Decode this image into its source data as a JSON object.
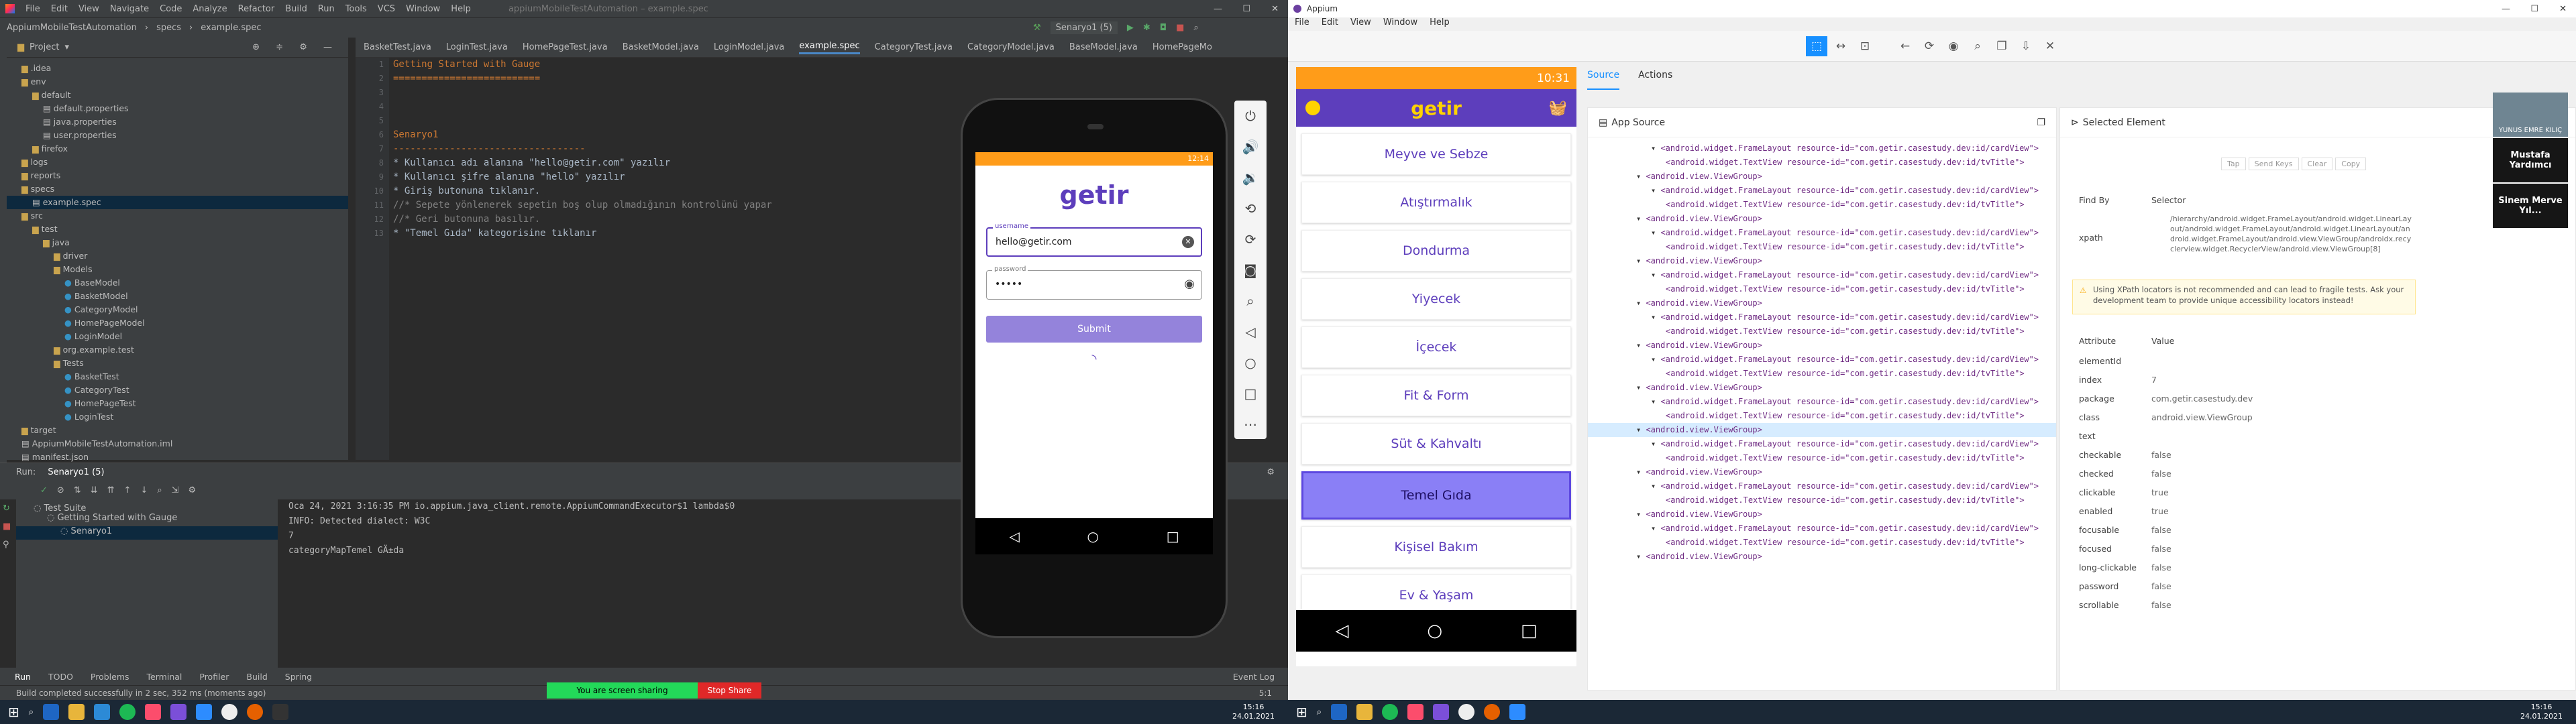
{
  "ide": {
    "menu": [
      "File",
      "Edit",
      "View",
      "Navigate",
      "Code",
      "Analyze",
      "Refactor",
      "Build",
      "Run",
      "Tools",
      "VCS",
      "Window",
      "Help"
    ],
    "window_title": "appiumMobileTestAutomation – example.spec",
    "breadcrumb": [
      "AppiumMobileTestAutomation",
      "specs",
      "example.spec"
    ],
    "run_config": "Senaryo1 (5)",
    "tabs": [
      "BasketTest.java",
      "LoginTest.java",
      "HomePageTest.java",
      "BasketModel.java",
      "LoginModel.java",
      "example.spec",
      "CategoryTest.java",
      "CategoryModel.java",
      "BaseModel.java",
      "HomePageMo"
    ],
    "active_tab": "example.spec",
    "project_label": "Project",
    "tree": [
      {
        "label": ".idea",
        "indent": 2,
        "type": "folder"
      },
      {
        "label": "env",
        "indent": 2,
        "type": "folder"
      },
      {
        "label": "default",
        "indent": 3,
        "type": "folder"
      },
      {
        "label": "default.properties",
        "indent": 4,
        "type": "file"
      },
      {
        "label": "java.properties",
        "indent": 4,
        "type": "file"
      },
      {
        "label": "user.properties",
        "indent": 4,
        "type": "file"
      },
      {
        "label": "firefox",
        "indent": 3,
        "type": "folder"
      },
      {
        "label": "logs",
        "indent": 2,
        "type": "folder"
      },
      {
        "label": "reports",
        "indent": 2,
        "type": "folder"
      },
      {
        "label": "specs",
        "indent": 2,
        "type": "folder"
      },
      {
        "label": "example.spec",
        "indent": 3,
        "type": "file",
        "selected": true
      },
      {
        "label": "src",
        "indent": 2,
        "type": "folder"
      },
      {
        "label": "test",
        "indent": 3,
        "type": "folder"
      },
      {
        "label": "java",
        "indent": 4,
        "type": "folder"
      },
      {
        "label": "driver",
        "indent": 5,
        "type": "folder"
      },
      {
        "label": "Models",
        "indent": 5,
        "type": "folder"
      },
      {
        "label": "BaseModel",
        "indent": 6,
        "type": "class"
      },
      {
        "label": "BasketModel",
        "indent": 6,
        "type": "class"
      },
      {
        "label": "CategoryModel",
        "indent": 6,
        "type": "class"
      },
      {
        "label": "HomePageModel",
        "indent": 6,
        "type": "class"
      },
      {
        "label": "LoginModel",
        "indent": 6,
        "type": "class"
      },
      {
        "label": "org.example.test",
        "indent": 5,
        "type": "folder"
      },
      {
        "label": "Tests",
        "indent": 5,
        "type": "folder"
      },
      {
        "label": "BasketTest",
        "indent": 6,
        "type": "class"
      },
      {
        "label": "CategoryTest",
        "indent": 6,
        "type": "class"
      },
      {
        "label": "HomePageTest",
        "indent": 6,
        "type": "class"
      },
      {
        "label": "LoginTest",
        "indent": 6,
        "type": "class"
      },
      {
        "label": "target",
        "indent": 2,
        "type": "folder"
      },
      {
        "label": "AppiumMobileTestAutomation.iml",
        "indent": 2,
        "type": "file"
      },
      {
        "label": "manifest.json",
        "indent": 2,
        "type": "file"
      }
    ],
    "code_lines": [
      "Getting Started with Gauge",
      "==========================",
      "",
      "",
      "",
      "Senaryo1",
      "----------------------------------",
      "* Kullanıcı adı alanına \"hello@getir.com\" yazılır",
      "* Kullanıcı şifre alanına \"hello\" yazılır",
      "* Giriş butonuna tıklanır.",
      "//* Sepete yönlenerek sepetin boş olup olmadığının kontrolünü yapar",
      "//* Geri butonuna basılır.",
      "* \"Temel Gıda\" kategorisine tıklanır"
    ],
    "line_numbers": [
      "1",
      "2",
      "3",
      "4",
      "5",
      "6",
      "7",
      "8",
      "9",
      "10",
      "11",
      "12",
      "13"
    ],
    "run": {
      "label": "Run:",
      "config": "Senaryo1 (5)",
      "tree": [
        "Test Suite",
        "Getting Started with Gauge",
        "Senaryo1"
      ],
      "output": [
        "Oca 24, 2021 3:16:35 PM io.appium.java_client.remote.AppiumCommandExecutor$1 lambda$0",
        "INFO: Detected dialect: W3C",
        "7",
        "categoryMapTemel GÄ±da"
      ]
    },
    "bottom_tabs": [
      "Run",
      "TODO",
      "Problems",
      "Terminal",
      "Profiler",
      "Build",
      "Spring"
    ],
    "event_log": "Event Log",
    "status": "Build completed successfully in 2 sec, 352 ms (moments ago)",
    "position": "5:1",
    "share_text": "You are screen sharing",
    "stop_share": "Stop Share"
  },
  "emulator": {
    "time": "12:14",
    "logo": "getir",
    "username_label": "username",
    "username_value": "hello@getir.com",
    "password_label": "password",
    "password_value": "•••••",
    "submit_label": "Submit"
  },
  "appium": {
    "title": "Appium",
    "menu": [
      "File",
      "Edit",
      "View",
      "Window",
      "Help"
    ],
    "tabs": [
      "Source",
      "Actions"
    ],
    "active_tab": "Source",
    "app_source_title": "App Source",
    "selected_title": "Selected Element",
    "phone": {
      "time": "10:31",
      "logo": "getir",
      "categories": [
        "Meyve ve Sebze",
        "Atıştırmalık",
        "Dondurma",
        "Yiyecek",
        "İçecek",
        "Fit & Form",
        "Süt & Kahvaltı",
        "Temel Gıda",
        "Kişisel Bakım",
        "Ev & Yaşam"
      ],
      "highlighted": "Temel Gıda"
    },
    "xml": [
      {
        "t": "<android.widget.FrameLayout resource-id=\"com.getir.casestudy.dev:id/cardView\">",
        "d": 2
      },
      {
        "t": "<android.widget.TextView resource-id=\"com.getir.casestudy.dev:id/tvTitle\">",
        "d": 3
      },
      {
        "t": "<android.view.ViewGroup>",
        "d": 1
      },
      {
        "t": "<android.widget.FrameLayout resource-id=\"com.getir.casestudy.dev:id/cardView\">",
        "d": 2
      },
      {
        "t": "<android.widget.TextView resource-id=\"com.getir.casestudy.dev:id/tvTitle\">",
        "d": 3
      },
      {
        "t": "<android.view.ViewGroup>",
        "d": 1
      },
      {
        "t": "<android.widget.FrameLayout resource-id=\"com.getir.casestudy.dev:id/cardView\">",
        "d": 2
      },
      {
        "t": "<android.widget.TextView resource-id=\"com.getir.casestudy.dev:id/tvTitle\">",
        "d": 3
      },
      {
        "t": "<android.view.ViewGroup>",
        "d": 1
      },
      {
        "t": "<android.widget.FrameLayout resource-id=\"com.getir.casestudy.dev:id/cardView\">",
        "d": 2
      },
      {
        "t": "<android.widget.TextView resource-id=\"com.getir.casestudy.dev:id/tvTitle\">",
        "d": 3
      },
      {
        "t": "<android.view.ViewGroup>",
        "d": 1
      },
      {
        "t": "<android.widget.FrameLayout resource-id=\"com.getir.casestudy.dev:id/cardView\">",
        "d": 2
      },
      {
        "t": "<android.widget.TextView resource-id=\"com.getir.casestudy.dev:id/tvTitle\">",
        "d": 3
      },
      {
        "t": "<android.view.ViewGroup>",
        "d": 1
      },
      {
        "t": "<android.widget.FrameLayout resource-id=\"com.getir.casestudy.dev:id/cardView\">",
        "d": 2
      },
      {
        "t": "<android.widget.TextView resource-id=\"com.getir.casestudy.dev:id/tvTitle\">",
        "d": 3
      },
      {
        "t": "<android.view.ViewGroup>",
        "d": 1
      },
      {
        "t": "<android.widget.FrameLayout resource-id=\"com.getir.casestudy.dev:id/cardView\">",
        "d": 2
      },
      {
        "t": "<android.widget.TextView resource-id=\"com.getir.casestudy.dev:id/tvTitle\">",
        "d": 3
      },
      {
        "t": "<android.view.ViewGroup>",
        "d": 1,
        "selected": true
      },
      {
        "t": "<android.widget.FrameLayout resource-id=\"com.getir.casestudy.dev:id/cardView\">",
        "d": 2
      },
      {
        "t": "<android.widget.TextView resource-id=\"com.getir.casestudy.dev:id/tvTitle\">",
        "d": 3
      },
      {
        "t": "<android.view.ViewGroup>",
        "d": 1
      },
      {
        "t": "<android.widget.FrameLayout resource-id=\"com.getir.casestudy.dev:id/cardView\">",
        "d": 2
      },
      {
        "t": "<android.widget.TextView resource-id=\"com.getir.casestudy.dev:id/tvTitle\">",
        "d": 3
      },
      {
        "t": "<android.view.ViewGroup>",
        "d": 1
      },
      {
        "t": "<android.widget.FrameLayout resource-id=\"com.getir.casestudy.dev:id/cardView\">",
        "d": 2
      },
      {
        "t": "<android.widget.TextView resource-id=\"com.getir.casestudy.dev:id/tvTitle\">",
        "d": 3
      },
      {
        "t": "<android.view.ViewGroup>",
        "d": 1
      }
    ],
    "actions": [
      "Tap",
      "Send Keys",
      "Clear",
      "Copy"
    ],
    "find_by_label": "Find By",
    "selector_label": "Selector",
    "xpath_label": "xpath",
    "xpath_value": "/hierarchy/android.widget.FrameLayout/android.widget.LinearLayout/android.widget.FrameLayout/android.widget.LinearLayout/android.widget.FrameLayout/android.view.ViewGroup/androidx.recyclerview.widget.RecyclerView/android.view.ViewGroup[8]",
    "warning": "Using XPath locators is not recommended and can lead to fragile tests. Ask your development team to provide unique accessibility locators instead!",
    "attr_header": [
      "Attribute",
      "Value"
    ],
    "attributes": [
      [
        "elementId",
        ""
      ],
      [
        "index",
        "7"
      ],
      [
        "package",
        "com.getir.casestudy.dev"
      ],
      [
        "class",
        "android.view.ViewGroup"
      ],
      [
        "text",
        ""
      ],
      [
        "checkable",
        "false"
      ],
      [
        "checked",
        "false"
      ],
      [
        "clickable",
        "true"
      ],
      [
        "enabled",
        "true"
      ],
      [
        "focusable",
        "false"
      ],
      [
        "focused",
        "false"
      ],
      [
        "long-clickable",
        "false"
      ],
      [
        "password",
        "false"
      ],
      [
        "scrollable",
        "false"
      ]
    ]
  },
  "video": {
    "participants": [
      "YUNUS EMRE KILIÇ",
      "Mustafa Yardımcı",
      "Sinem Merve Yıl..."
    ]
  },
  "clock": {
    "time": "15:16",
    "date": "24.01.2021"
  },
  "clock2": {
    "time": "15:16",
    "date": "24.01.2021"
  },
  "colors": {
    "getir_purple": "#5d3ebc",
    "getir_yellow": "#ffd300",
    "status_orange": "#ff9c19",
    "intellij_bg": "#2b2b2b"
  }
}
